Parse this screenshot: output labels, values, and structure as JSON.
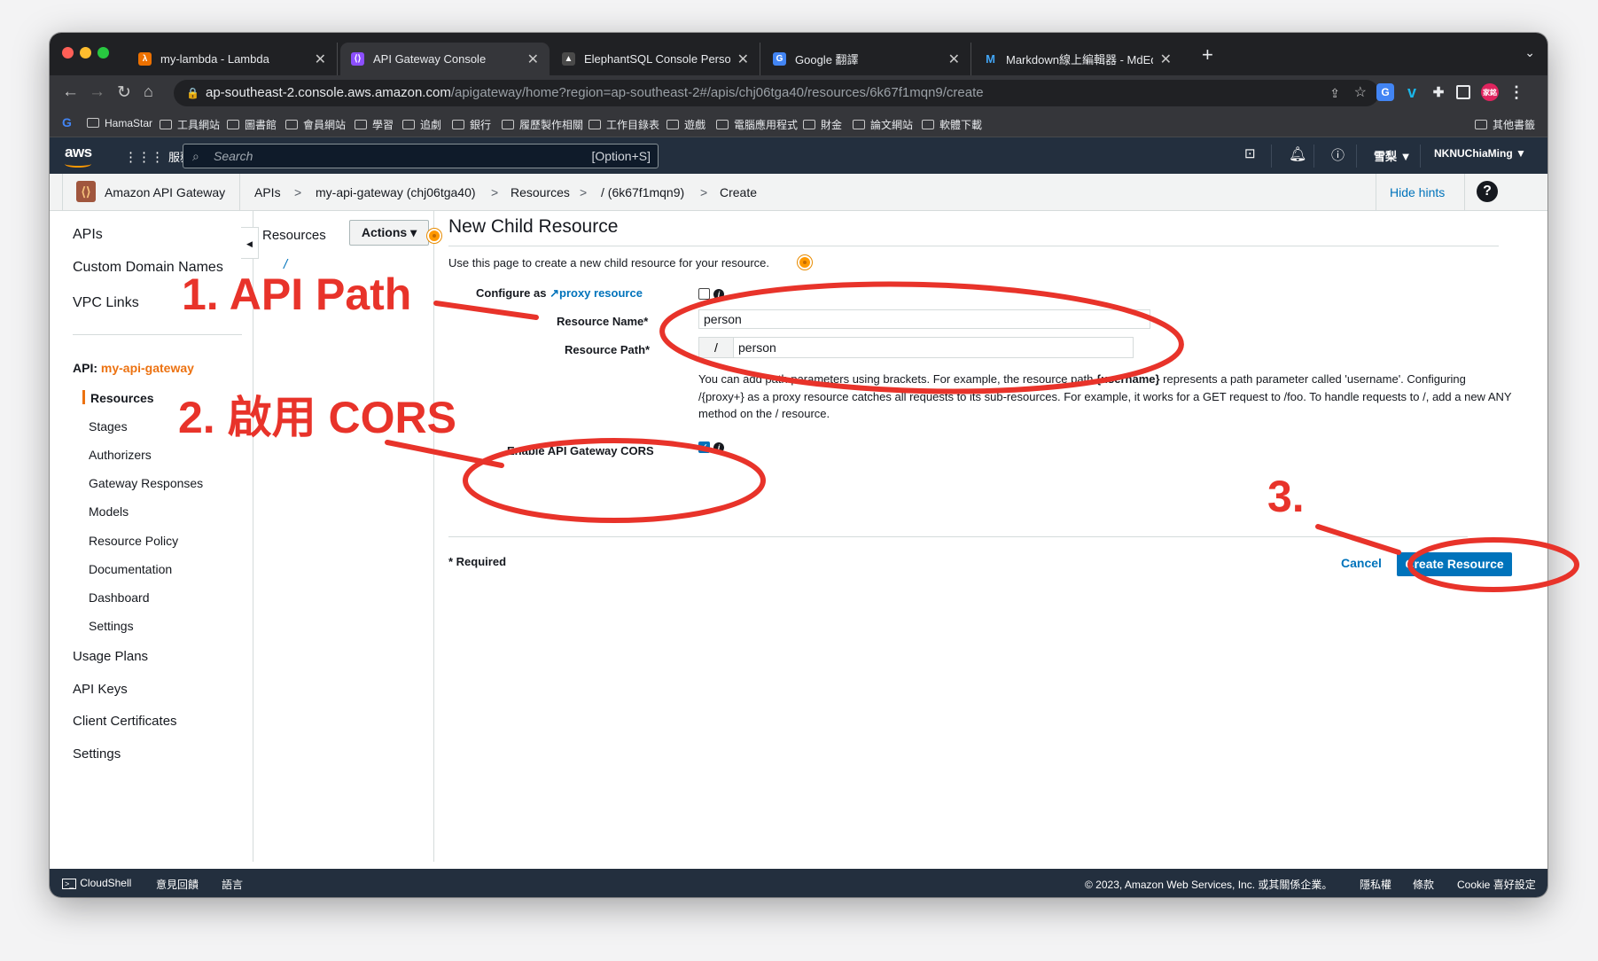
{
  "tabs": [
    {
      "title": "my-lambda - Lambda",
      "favicon": "lambda-icon",
      "color": "#ed7100"
    },
    {
      "title": "API Gateway Console",
      "favicon": "api-gateway-icon",
      "color": "#8c4fff"
    },
    {
      "title": "ElephantSQL Console Personal",
      "favicon": "elephant-icon",
      "color": "#4a4a4a"
    },
    {
      "title": "Google 翻譯",
      "favicon": "translate-icon",
      "color": "#4285f4"
    },
    {
      "title": "Markdown線上編輯器 - MdEditor",
      "favicon": "mdeditor-icon",
      "color": "#1e88e5"
    }
  ],
  "browser": {
    "url_host": "ap-southeast-2.console.aws.amazon.com",
    "url_path": "/apigateway/home?region=ap-southeast-2#/apis/chj06tga40/resources/6k67f1mqn9/create",
    "profile_label": "家銘"
  },
  "bookmarks": [
    "HamaStar",
    "工具網站",
    "圖書館",
    "會員網站",
    "學習",
    "追劇",
    "銀行",
    "履歷製作相關",
    "工作目錄表",
    "遊戲",
    "電腦應用程式",
    "財金",
    "論文網站",
    "軟體下載"
  ],
  "bookmarks_other": "其他書籤",
  "aws": {
    "logo": "aws",
    "services": "服務",
    "search_placeholder": "Search",
    "search_shortcut": "[Option+S]",
    "region": "雪梨 ▼",
    "account": "NKNUChiaMing ▼"
  },
  "breadcrumb": {
    "service": "Amazon API Gateway",
    "items": [
      "APIs",
      "my-api-gateway (chj06tga40)",
      "Resources",
      "/ (6k67f1mqn9)",
      "Create"
    ],
    "separator": ">",
    "hide_hints": "Hide hints",
    "help": "?"
  },
  "leftnav": {
    "top": [
      "APIs",
      "Custom Domain Names",
      "VPC Links"
    ],
    "api_prefix": "API:",
    "api_name": "my-api-gateway",
    "sub": [
      "Resources",
      "Stages",
      "Authorizers",
      "Gateway Responses",
      "Models",
      "Resource Policy",
      "Documentation",
      "Dashboard",
      "Settings"
    ],
    "bottom": [
      "Usage Plans",
      "API Keys",
      "Client Certificates",
      "Settings"
    ]
  },
  "resources_panel": {
    "title": "Resources",
    "actions": "Actions ▾",
    "root": "/"
  },
  "form": {
    "title": "New Child Resource",
    "description": "Use this page to create a new child resource for your resource.",
    "configure_prefix": "Configure as",
    "proxy_link": "proxy resource",
    "name_label": "Resource Name*",
    "name_value": "person",
    "path_label": "Resource Path*",
    "path_prefix": "/",
    "path_value": "person",
    "hint_1a": "You can add path parameters using brackets. For example, the resource path ",
    "hint_1b": "{username}",
    "hint_1c": " represents a path parameter called 'username'. Configuring /{proxy+} as a proxy resource catches all requests to its sub-resources. For example, it works for a GET request to /foo. To handle requests to /, add a new ANY method on the / resource.",
    "cors_label": "Enable API Gateway CORS",
    "cors_checked": true,
    "proxy_checked": false,
    "required_note": "* Required",
    "cancel": "Cancel",
    "create": "Create Resource"
  },
  "footer": {
    "cloudshell": "CloudShell",
    "feedback": "意見回饋",
    "language": "語言",
    "copyright": "© 2023, Amazon Web Services, Inc. 或其關係企業。",
    "privacy": "隱私權",
    "terms": "條款",
    "cookies": "Cookie 喜好設定"
  },
  "annotations": {
    "step1": "1. API Path",
    "step2": "2. 啟用 CORS",
    "step3": "3.",
    "color": "#e8332a"
  }
}
